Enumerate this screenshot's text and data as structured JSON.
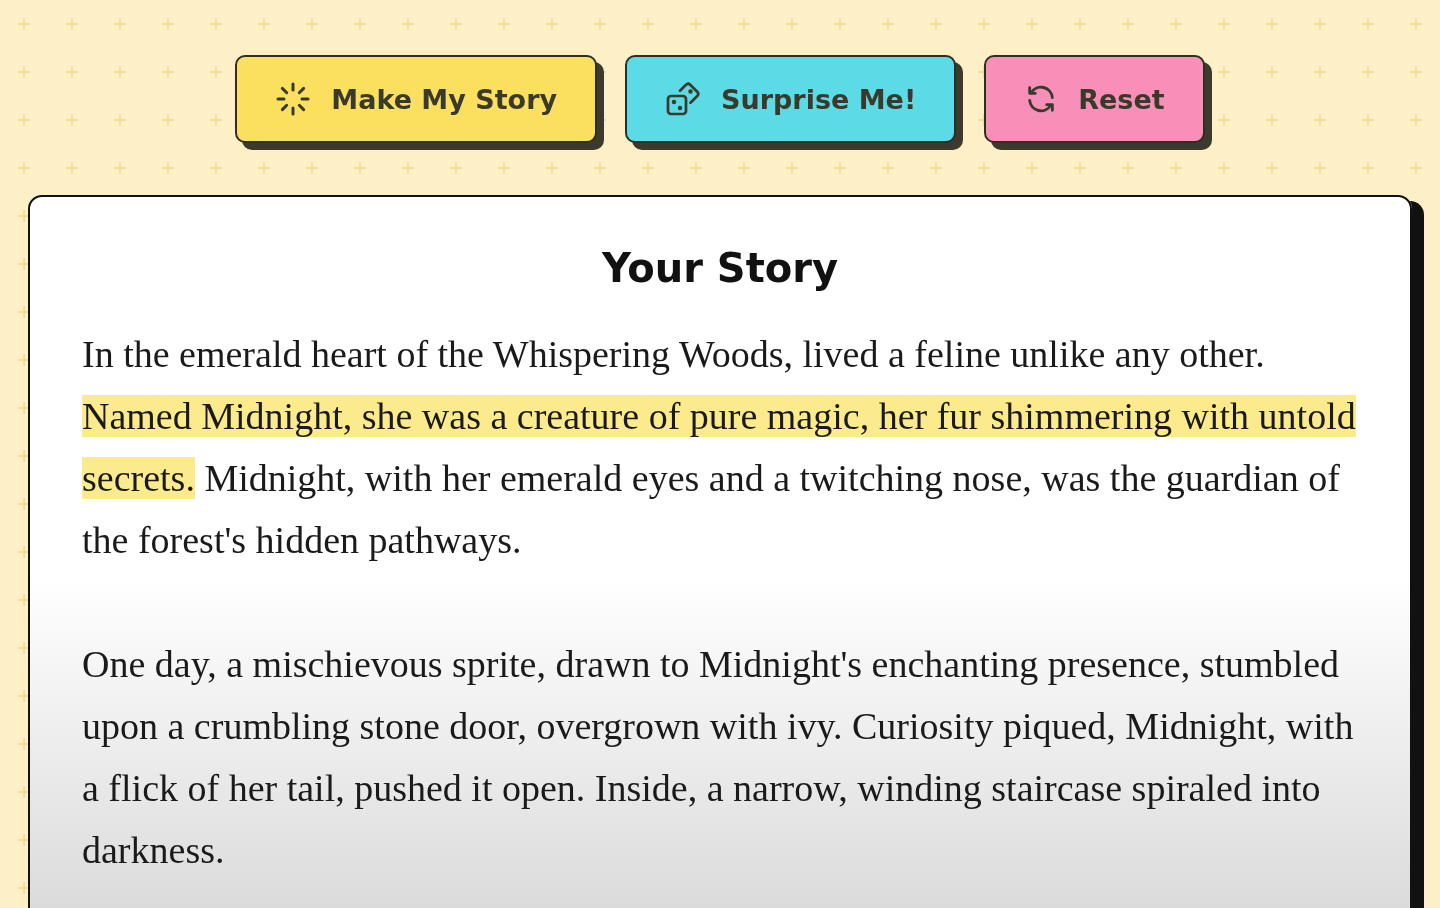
{
  "buttons": [
    {
      "label": "Make My Story",
      "kind": "sparkle",
      "color": "#fbdf5e"
    },
    {
      "label": "Surprise Me!",
      "kind": "dice",
      "color": "#5cdbe6"
    },
    {
      "label": "Reset",
      "kind": "refresh",
      "color": "#f78fb8"
    }
  ],
  "story": {
    "title": "Your Story",
    "paragraphs": [
      [
        {
          "text": "In the emerald heart of the Whispering Woods, lived a feline unlike any other. ",
          "highlighted": false
        },
        {
          "text": "Named Midnight, she was a creature of pure magic, her fur shimmering with untold secrets.",
          "highlighted": true
        },
        {
          "text": " Midnight, with her emerald eyes and a twitching nose, was the guardian of the forest's hidden pathways.",
          "highlighted": false
        }
      ],
      [
        {
          "text": "One day, a mischievous sprite, drawn to Midnight's enchanting presence, stumbled upon a crumbling stone door, overgrown with ivy. Curiosity piqued, Midnight, with a flick of her tail, pushed it open. Inside, a narrow, winding staircase spiraled into darkness.",
          "highlighted": false
        }
      ]
    ]
  }
}
